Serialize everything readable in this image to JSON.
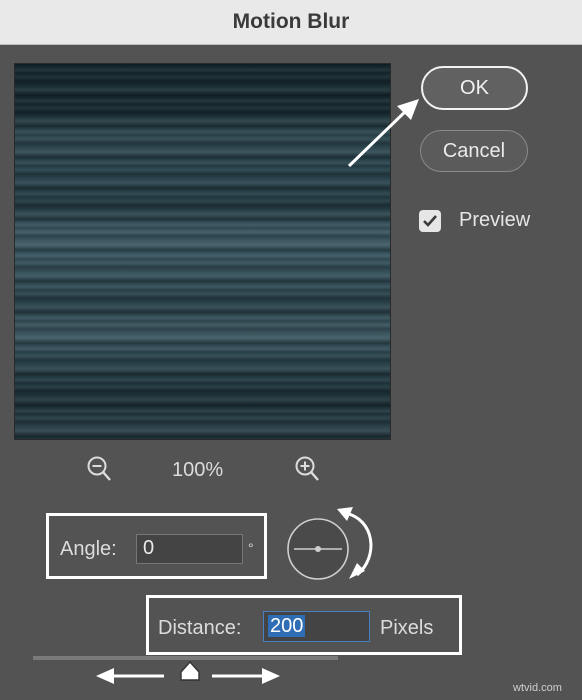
{
  "dialog": {
    "title": "Motion Blur"
  },
  "buttons": {
    "ok": "OK",
    "cancel": "Cancel"
  },
  "preview": {
    "label": "Preview",
    "checked": true
  },
  "zoom": {
    "percent": "100%"
  },
  "angle": {
    "label": "Angle:",
    "value": "0",
    "unit": "°"
  },
  "distance": {
    "label": "Distance:",
    "value": "200",
    "unit": "Pixels"
  },
  "watermark": "wtvid.com",
  "icons": [
    "zoom-out-icon",
    "zoom-in-icon",
    "angle-wheel-icon",
    "rotate-arrow-icon",
    "checkmark-icon",
    "slider-thumb-icon"
  ],
  "colors": {
    "background": "#535353",
    "titlebar": "#e9e9e9",
    "highlight": "#2f6db5",
    "annotation": "#ffffff"
  }
}
